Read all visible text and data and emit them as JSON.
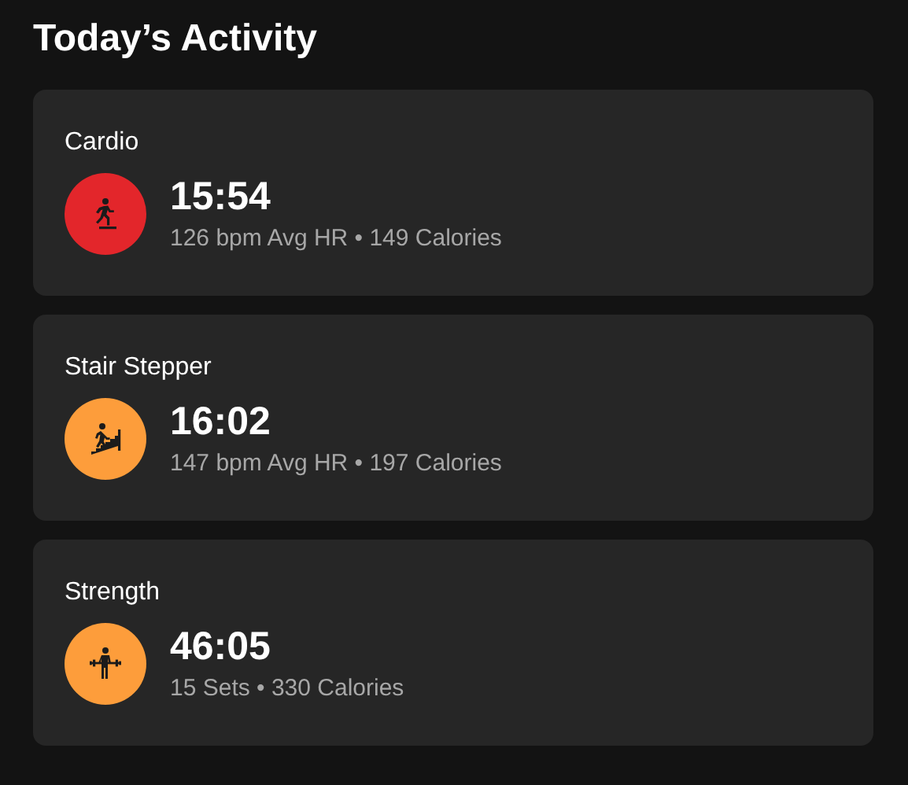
{
  "title": "Today’s Activity",
  "activities": [
    {
      "name": "Cardio",
      "kind": "cardio",
      "color": "#e3262b",
      "duration": "15:54",
      "details": "126 bpm Avg HR • 149 Calories"
    },
    {
      "name": "Stair Stepper",
      "kind": "stair",
      "color": "#fd9d3b",
      "duration": "16:02",
      "details": "147 bpm Avg HR • 197 Calories"
    },
    {
      "name": "Strength",
      "kind": "strength",
      "color": "#fd9d3b",
      "duration": "46:05",
      "details": "15 Sets • 330 Calories"
    }
  ]
}
